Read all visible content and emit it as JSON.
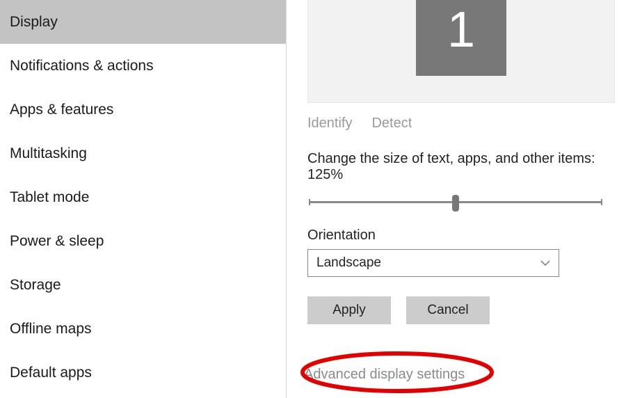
{
  "sidebar": {
    "items": [
      {
        "label": "Display",
        "selected": true
      },
      {
        "label": "Notifications & actions",
        "selected": false
      },
      {
        "label": "Apps & features",
        "selected": false
      },
      {
        "label": "Multitasking",
        "selected": false
      },
      {
        "label": "Tablet mode",
        "selected": false
      },
      {
        "label": "Power & sleep",
        "selected": false
      },
      {
        "label": "Storage",
        "selected": false
      },
      {
        "label": "Offline maps",
        "selected": false
      },
      {
        "label": "Default apps",
        "selected": false
      }
    ]
  },
  "display": {
    "monitor_number": "1",
    "identify_label": "Identify",
    "detect_label": "Detect",
    "scale_label": "Change the size of text, apps, and other items: 125%",
    "scale_percent": 50,
    "orientation_label": "Orientation",
    "orientation_value": "Landscape",
    "apply_label": "Apply",
    "cancel_label": "Cancel",
    "advanced_label": "Advanced display settings"
  }
}
